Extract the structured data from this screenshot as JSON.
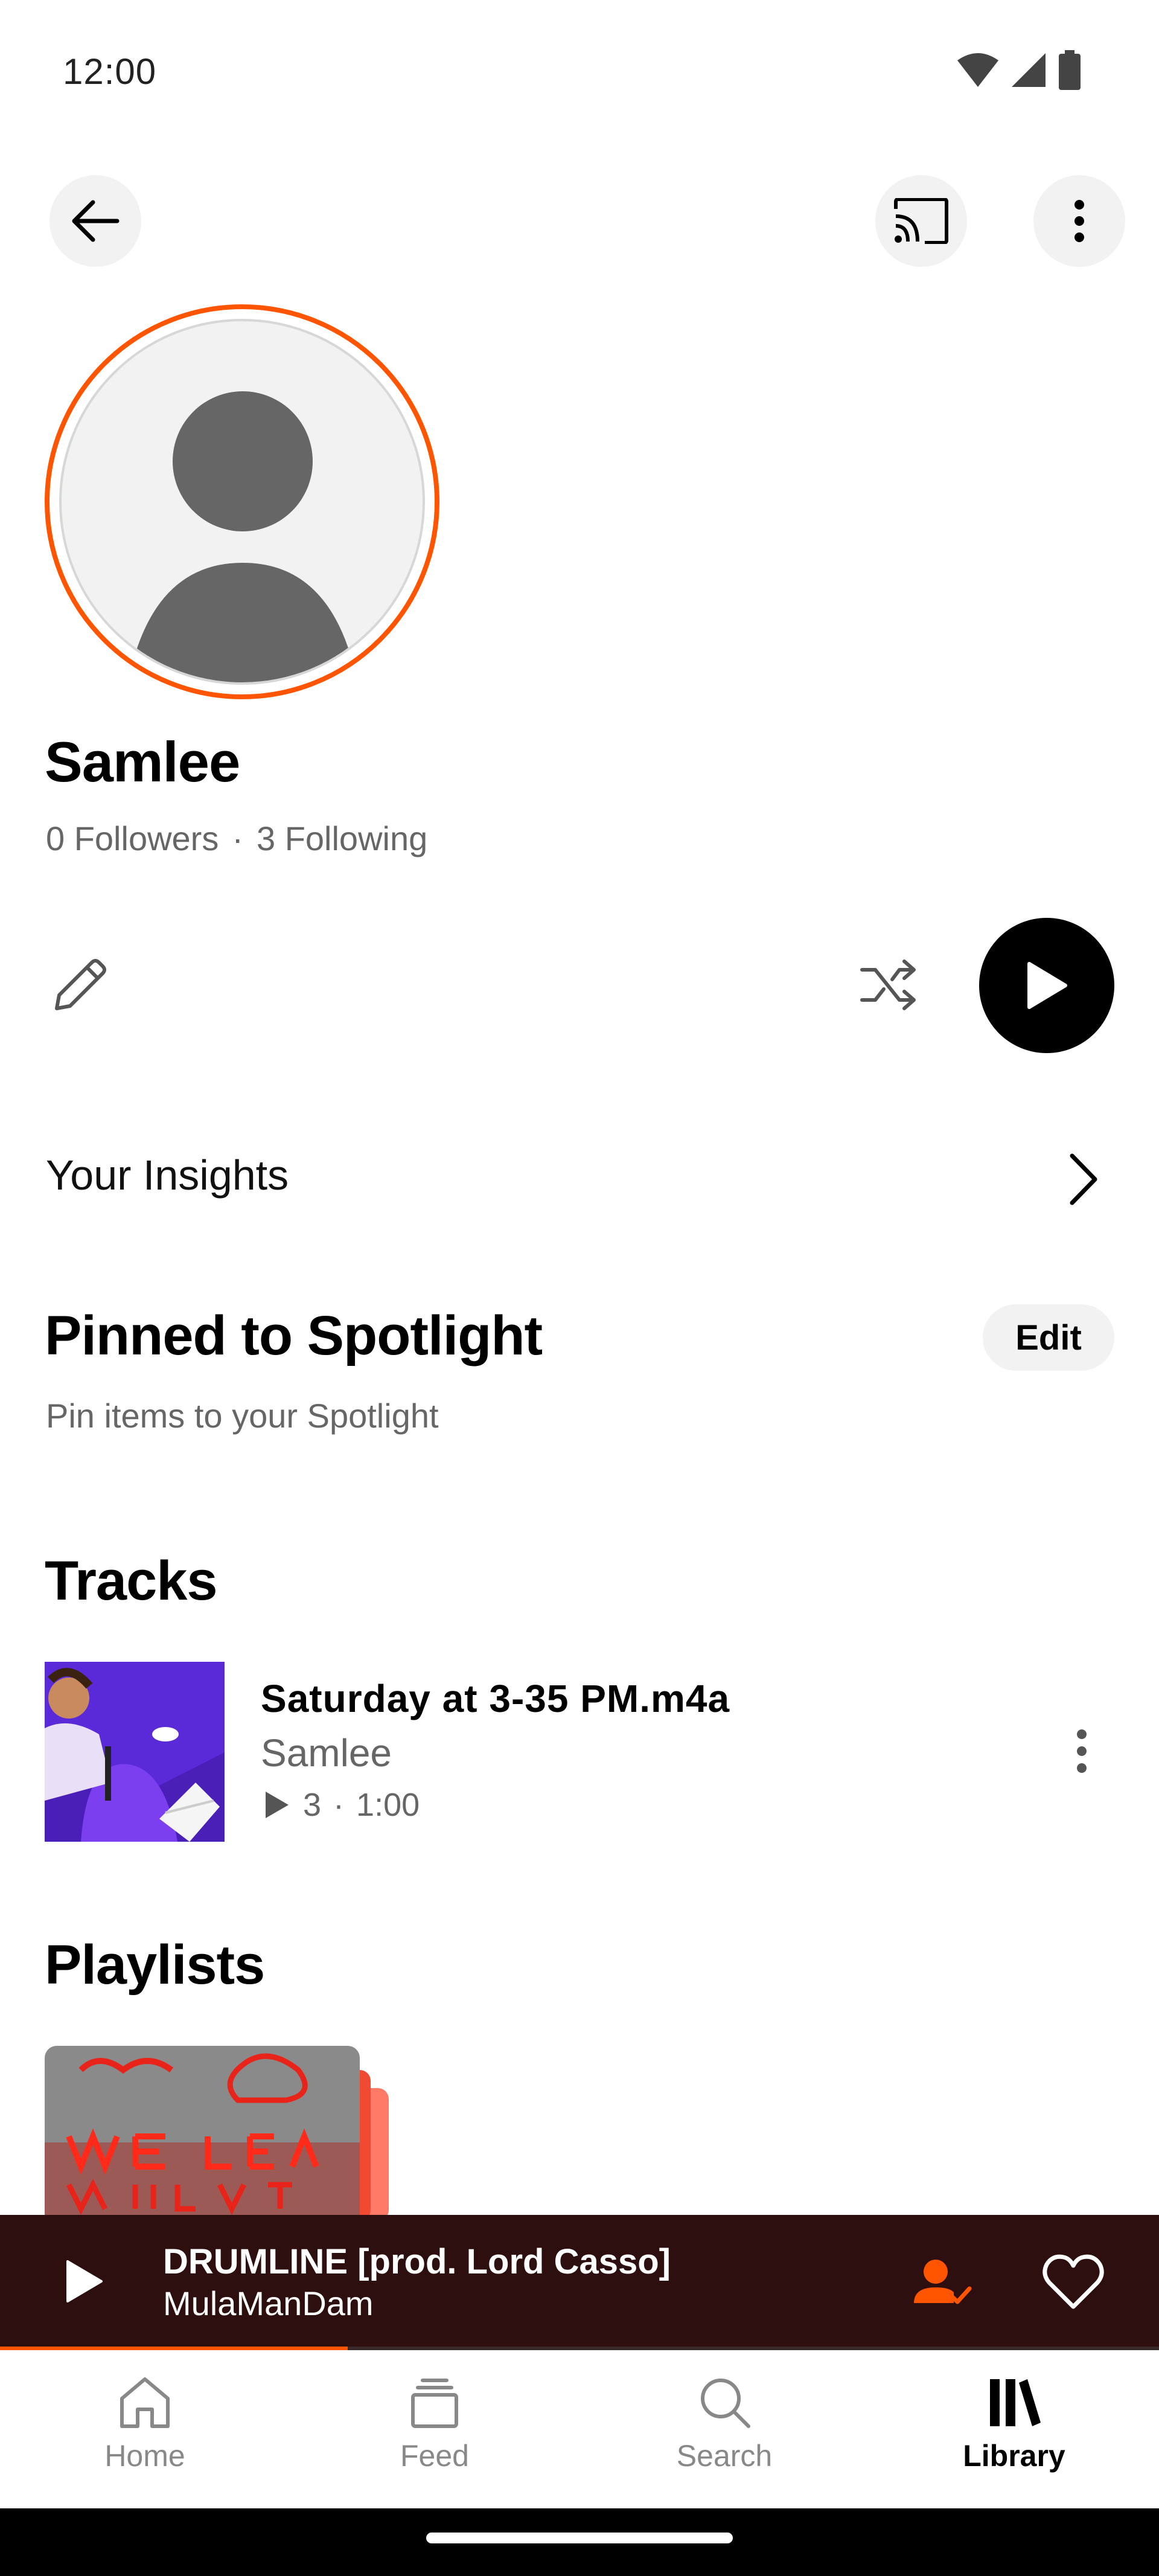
{
  "status_bar": {
    "time": "12:00"
  },
  "profile": {
    "name": "Samlee",
    "followers": "0 Followers",
    "separator": "·",
    "following": "3 Following"
  },
  "insights": {
    "label": "Your Insights"
  },
  "pinned": {
    "title": "Pinned to Spotlight",
    "subtitle": "Pin items to your Spotlight",
    "edit_label": "Edit"
  },
  "tracks": {
    "title": "Tracks",
    "items": [
      {
        "title": "Saturday at 3-35 PM.m4a",
        "artist": "Samlee",
        "plays": "3",
        "separator": "·",
        "duration": "1:00"
      }
    ]
  },
  "playlists": {
    "title": "Playlists"
  },
  "mini_player": {
    "title": "DRUMLINE [prod. Lord Casso]",
    "artist": "MulaManDam",
    "progress": 0.3
  },
  "nav": {
    "items": [
      {
        "label": "Home",
        "icon": "home-icon",
        "active": false
      },
      {
        "label": "Feed",
        "icon": "feed-icon",
        "active": false
      },
      {
        "label": "Search",
        "icon": "search-icon",
        "active": false
      },
      {
        "label": "Library",
        "icon": "library-icon",
        "active": true
      }
    ]
  },
  "colors": {
    "accent": "#ff5500",
    "mini_player_bg": "#2c0f0e",
    "surface": "#f2f2f2"
  }
}
